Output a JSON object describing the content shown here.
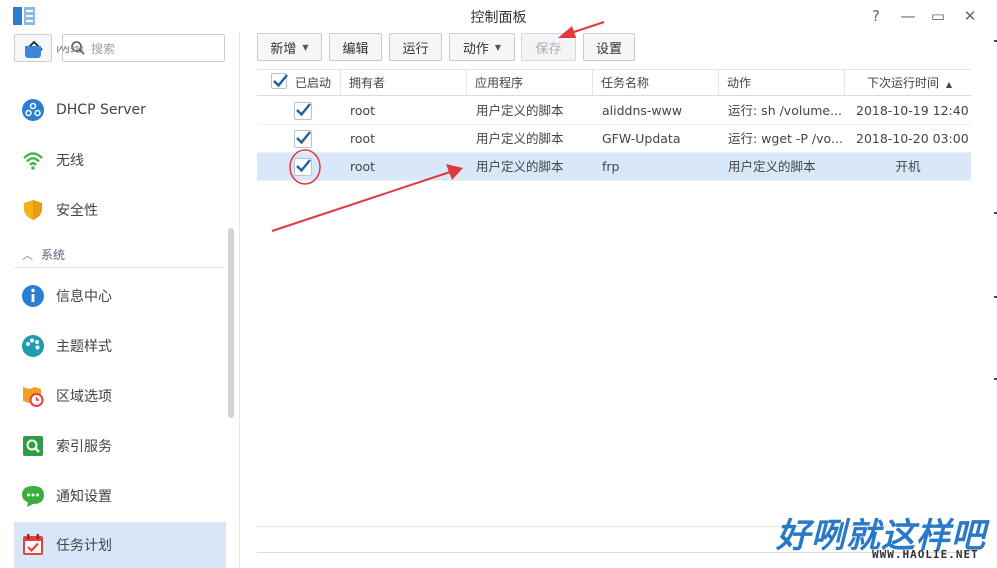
{
  "window": {
    "title": "控制面板",
    "help": "?",
    "minimize": "—",
    "maximize": "▭",
    "close": "✕"
  },
  "sidebar": {
    "search_placeholder": "搜索",
    "partial_top_label": "网络",
    "items": [
      {
        "label": "DHCP Server",
        "icon": "dhcp-icon"
      },
      {
        "label": "无线",
        "icon": "wifi-icon"
      },
      {
        "label": "安全性",
        "icon": "shield-icon"
      }
    ],
    "section": {
      "label": "系统",
      "icon": "chevron-up-icon"
    },
    "system_items": [
      {
        "label": "信息中心",
        "icon": "info-icon"
      },
      {
        "label": "主题样式",
        "icon": "palette-icon"
      },
      {
        "label": "区域选项",
        "icon": "region-clock-icon"
      },
      {
        "label": "索引服务",
        "icon": "index-search-icon"
      },
      {
        "label": "通知设置",
        "icon": "chat-bubble-icon"
      },
      {
        "label": "任务计划",
        "icon": "calendar-check-icon",
        "active": true
      }
    ]
  },
  "toolbar": {
    "new_label": "新增",
    "edit_label": "编辑",
    "run_label": "运行",
    "action_label": "动作",
    "save_label": "保存",
    "settings_label": "设置"
  },
  "table": {
    "columns": [
      "已启动",
      "拥有者",
      "应用程序",
      "任务名称",
      "动作",
      "下次运行时间"
    ],
    "sort_indicator": "▲",
    "rows": [
      {
        "enabled": true,
        "owner": "root",
        "app": "用户定义的脚本",
        "task": "aliddns-www",
        "action": "运行: sh /volume...",
        "next": "2018-10-19 12:40"
      },
      {
        "enabled": true,
        "owner": "root",
        "app": "用户定义的脚本",
        "task": "GFW-Updata",
        "action": "运行: wget -P /vo...",
        "next": "2018-10-20 03:00"
      },
      {
        "enabled": true,
        "owner": "root",
        "app": "用户定义的脚本",
        "task": "frp",
        "action": "用户定义的脚本",
        "next": "开机",
        "selected": true
      }
    ]
  },
  "watermark": {
    "main": "好咧就这样吧",
    "url": "WWW.HAOLIE.NET"
  },
  "colors": {
    "accent": "#2a78c8",
    "selected_row": "#d9e8f8",
    "annotation_red": "#e0393e"
  }
}
